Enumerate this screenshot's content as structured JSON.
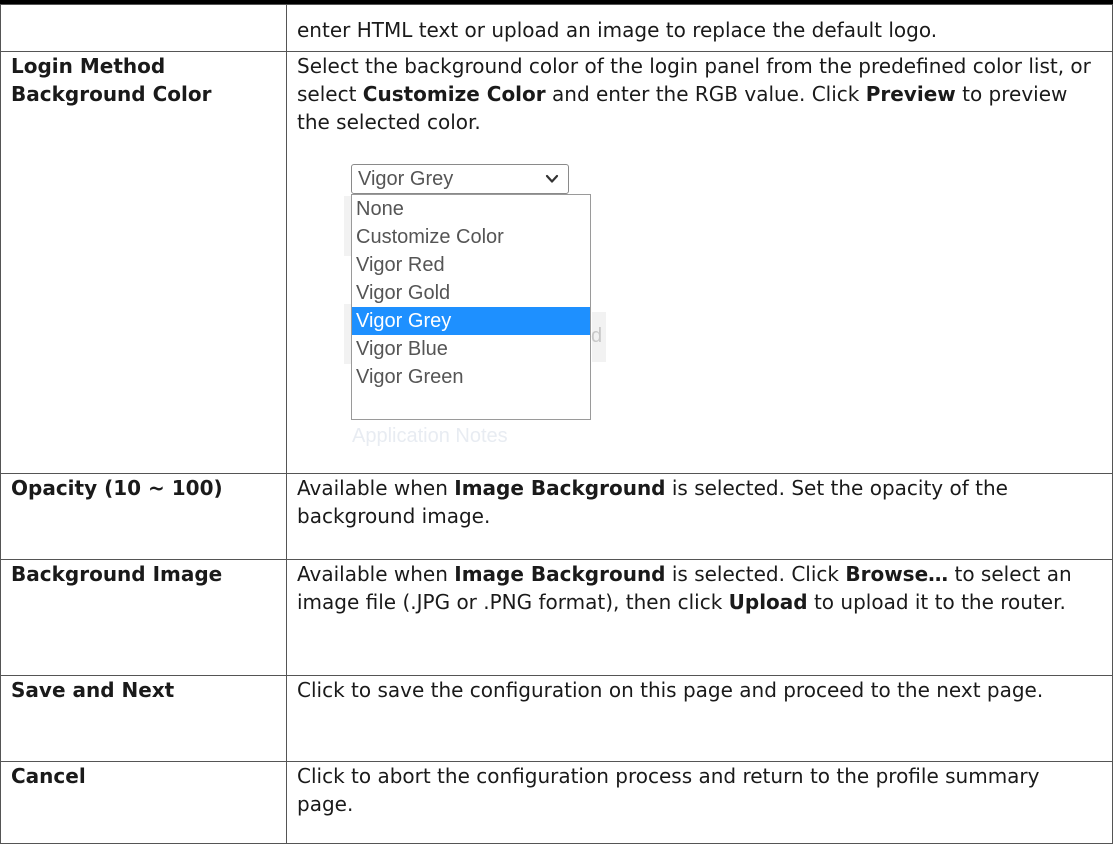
{
  "rows": [
    {
      "term": "",
      "desc": "enter HTML text or upload an image to replace the default logo."
    },
    {
      "term": "Login Method Background Color",
      "desc_parts": [
        "Select the background color of the login panel from the predefined color list, or select ",
        "Customize Color",
        " and enter the RGB value. Click ",
        "Preview",
        " to preview the selected color."
      ]
    },
    {
      "term": "Opacity (10 ~ 100)",
      "desc_parts": [
        "Available when ",
        "Image Background",
        " is selected. Set the opacity of the background image."
      ]
    },
    {
      "term": "Background Image",
      "desc_parts": [
        "Available when ",
        "Image Background",
        " is selected. Click ",
        "Browse…",
        " to select an image file (.JPG or .PNG format), then click ",
        "Upload",
        " to upload it to the router."
      ]
    },
    {
      "term": "Save and Next",
      "desc": "Click to save the configuration on this page and proceed to the next page."
    },
    {
      "term": "Cancel",
      "desc": "Click to abort the configuration process and return to the profile summary page."
    }
  ],
  "dropdown": {
    "selected": "Vigor Grey",
    "options": [
      "None",
      "Customize Color",
      "Vigor Red",
      "Vigor Gold",
      "Vigor Grey",
      "Vigor Blue",
      "Vigor Green"
    ],
    "highlight_color": "#1e90ff",
    "behind_fragment": "d",
    "behind_footer_text": "Application Notes"
  }
}
